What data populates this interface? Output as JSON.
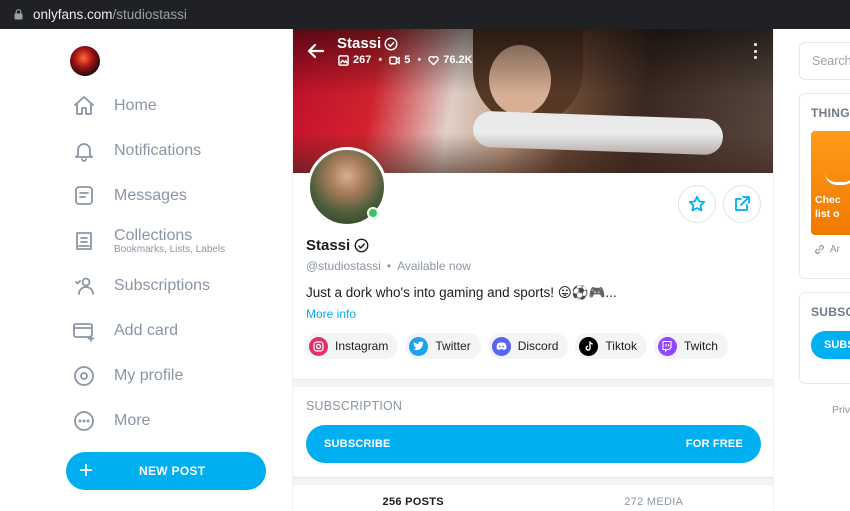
{
  "browser": {
    "domain": "onlyfans.com",
    "path": "/studiostassi"
  },
  "sidebar": {
    "items": [
      {
        "label": "Home",
        "icon": "home-icon"
      },
      {
        "label": "Notifications",
        "icon": "bell-icon"
      },
      {
        "label": "Messages",
        "icon": "message-icon"
      },
      {
        "label": "Collections",
        "sublabel": "Bookmarks, Lists, Labels",
        "icon": "collections-icon"
      },
      {
        "label": "Subscriptions",
        "icon": "subscriptions-icon"
      },
      {
        "label": "Add card",
        "icon": "card-icon"
      },
      {
        "label": "My profile",
        "icon": "profile-icon"
      },
      {
        "label": "More",
        "icon": "more-icon"
      }
    ],
    "new_post_label": "NEW POST"
  },
  "profile": {
    "name": "Stassi",
    "photos_count": "267",
    "videos_count": "5",
    "likes_count": "76.2K",
    "handle": "@studiostassi",
    "availability": "Available now",
    "bio": "Just a dork who's into gaming and sports! 😛⚽🎮...",
    "more_info": "More info",
    "socials": [
      {
        "label": "Instagram",
        "color": "#e1306c"
      },
      {
        "label": "Twitter",
        "color": "#1da1f2"
      },
      {
        "label": "Discord",
        "color": "#5865f2"
      },
      {
        "label": "Tiktok",
        "color": "#000000"
      },
      {
        "label": "Twitch",
        "color": "#9146ff"
      }
    ]
  },
  "subscription": {
    "heading": "SUBSCRIPTION",
    "button_label": "SUBSCRIBE",
    "price_label": "FOR FREE"
  },
  "tabs": {
    "posts": "256 POSTS",
    "media": "272 MEDIA"
  },
  "right_panel": {
    "search_placeholder": "Search",
    "card_title": "THING",
    "promo_line1": "Chec",
    "promo_line2": "list o",
    "footer_text": "Ar",
    "subscribe_title": "SUBSC",
    "subscribe_button": "SUBS",
    "privacy": "Priv"
  },
  "colors": {
    "accent": "#00aff0",
    "muted": "#8a96a3",
    "online": "#30c85f"
  }
}
